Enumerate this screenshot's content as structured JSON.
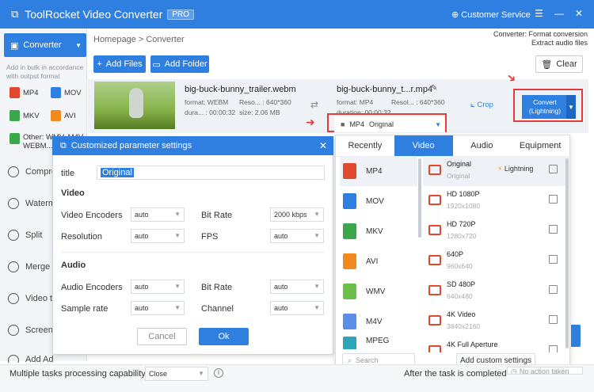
{
  "titlebar": {
    "app_title": "ToolRocket Video Converter",
    "badge": "PRO",
    "service": "Customer Service",
    "logo_glyph": "⧉"
  },
  "sidebar": {
    "active": "Converter",
    "note": "Add in bulk in accordance with output format",
    "formats": [
      "MP4",
      "MOV",
      "MKV",
      "AVI",
      "Other: WMV, M4V WEBM..."
    ],
    "items": [
      "Compre",
      "Waterm",
      "Split",
      "Merge",
      "Video t",
      "Screen",
      "Add Ad"
    ]
  },
  "breadcrumb": "Homepage > Converter",
  "topright": {
    "line1": "Converter: Format conversion",
    "line2": "Extract audio files"
  },
  "toolbar": {
    "add_files": "Add Files",
    "add_folder": "Add Folder",
    "clear": "Clear"
  },
  "task": {
    "src_name": "big-buck-bunny_trailer.webm",
    "src_format": "format: WEBM",
    "src_reso": "Reso... : 640*360",
    "src_duration": "dura... : 00:00:32",
    "src_size": "size: 2.06 MB",
    "dst_name": "big-buck-bunny_t...r.mp4",
    "dst_format": "format: MP4",
    "dst_reso": "Resol... : 640*360",
    "dst_duration": "duration: 00:00:32",
    "crop": "Crop",
    "convert_line1": "Convert",
    "convert_line2": "(Lightning)",
    "selector_format": "MP4",
    "selector_quality": "Original"
  },
  "dialog": {
    "title": "Customized parameter settings",
    "title_label": "title",
    "title_value": "Original",
    "video_section": "Video",
    "audio_section": "Audio",
    "video_encoders": "Video Encoders",
    "video_encoders_value": "auto",
    "bit_rate": "Bit Rate",
    "bit_rate_value": "2000 kbps",
    "resolution": "Resolution",
    "resolution_value": "auto",
    "fps": "FPS",
    "fps_value": "auto",
    "audio_encoders": "Audio Encoders",
    "audio_encoders_value": "auto",
    "audio_bit_rate": "Bit Rate",
    "audio_bit_rate_value": "auto",
    "sample_rate": "Sample rate",
    "sample_rate_value": "auto",
    "channel": "Channel",
    "channel_value": "auto",
    "cancel": "Cancel",
    "ok": "Ok"
  },
  "format_panel": {
    "tabs": [
      "Recently",
      "Video",
      "Audio",
      "Equipment"
    ],
    "formats": [
      "MP4",
      "MOV",
      "MKV",
      "AVI",
      "WMV",
      "M4V",
      "MPEG"
    ],
    "qualities": [
      {
        "name": "Original",
        "sub": "Original",
        "badge": "Lightning"
      },
      {
        "name": "HD 1080P",
        "sub": "1920x1080"
      },
      {
        "name": "HD 720P",
        "sub": "1280x720"
      },
      {
        "name": "640P",
        "sub": "960x640"
      },
      {
        "name": "SD 480P",
        "sub": "640x480"
      },
      {
        "name": "4K Video",
        "sub": "3840x2160"
      },
      {
        "name": "4K Full Aperture",
        "sub": ""
      }
    ],
    "search_placeholder": "Search",
    "add_custom": "Add custom settings"
  },
  "bottom": {
    "multi_label": "Multiple tasks processing capability",
    "multi_value": "Close",
    "after_label": "After the task is completed",
    "after_value": "No action taken"
  },
  "colors": {
    "primary": "#2f7fe0",
    "highlight_red": "#e53b3b",
    "mp4": "#e0492e",
    "mov": "#2f7fe0",
    "mkv": "#3aa84a",
    "avi": "#f08a1c",
    "wmv": "#6cc04a",
    "m4v": "#5a8ee8",
    "mpeg": "#2ca5b8"
  }
}
